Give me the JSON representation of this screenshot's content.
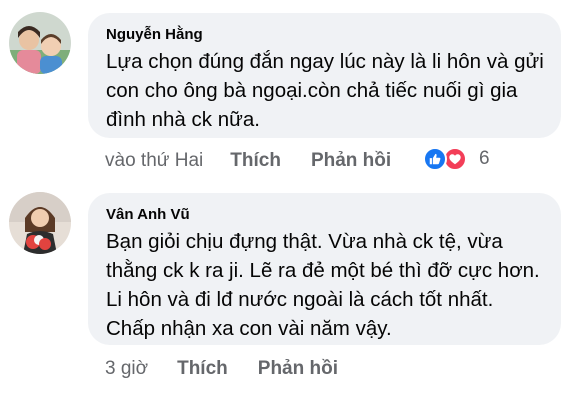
{
  "comments": [
    {
      "author": "Nguyễn Hằng",
      "lines": [
        "Lựa chọn đúng đắn ngay lúc này là li hôn và gửi",
        "con cho ông bà ngoại.còn chả tiếc nuối gì gia",
        "đình nhà ck nữa."
      ],
      "time": "vào thứ Hai",
      "like_label": "Thích",
      "reply_label": "Phản hồi",
      "reaction_count": "6",
      "reaction_icons": [
        "like-icon",
        "love-icon"
      ],
      "avatar_icon": "avatar-photo-mother-child"
    },
    {
      "author": "Vân Anh Vũ",
      "lines": [
        "Bạn giỏi chịu đựng thật.  Vừa nhà ck tệ,  vừa",
        "thằng ck k ra ji. Lẽ ra đẻ một bé thì đỡ cực hơn.",
        "Li hôn và đi lđ nước ngoài là cách tốt nhất.",
        "Chấp nhận xa con vài năm vậy."
      ],
      "time": "3 giờ",
      "like_label": "Thích",
      "reply_label": "Phản hồi",
      "avatar_icon": "avatar-photo-woman-flowers"
    }
  ],
  "colors": {
    "bubble": "#f0f2f5",
    "secondary_text": "#65676b",
    "like_blue": "#1877f2",
    "love_red": "#f33e58"
  }
}
